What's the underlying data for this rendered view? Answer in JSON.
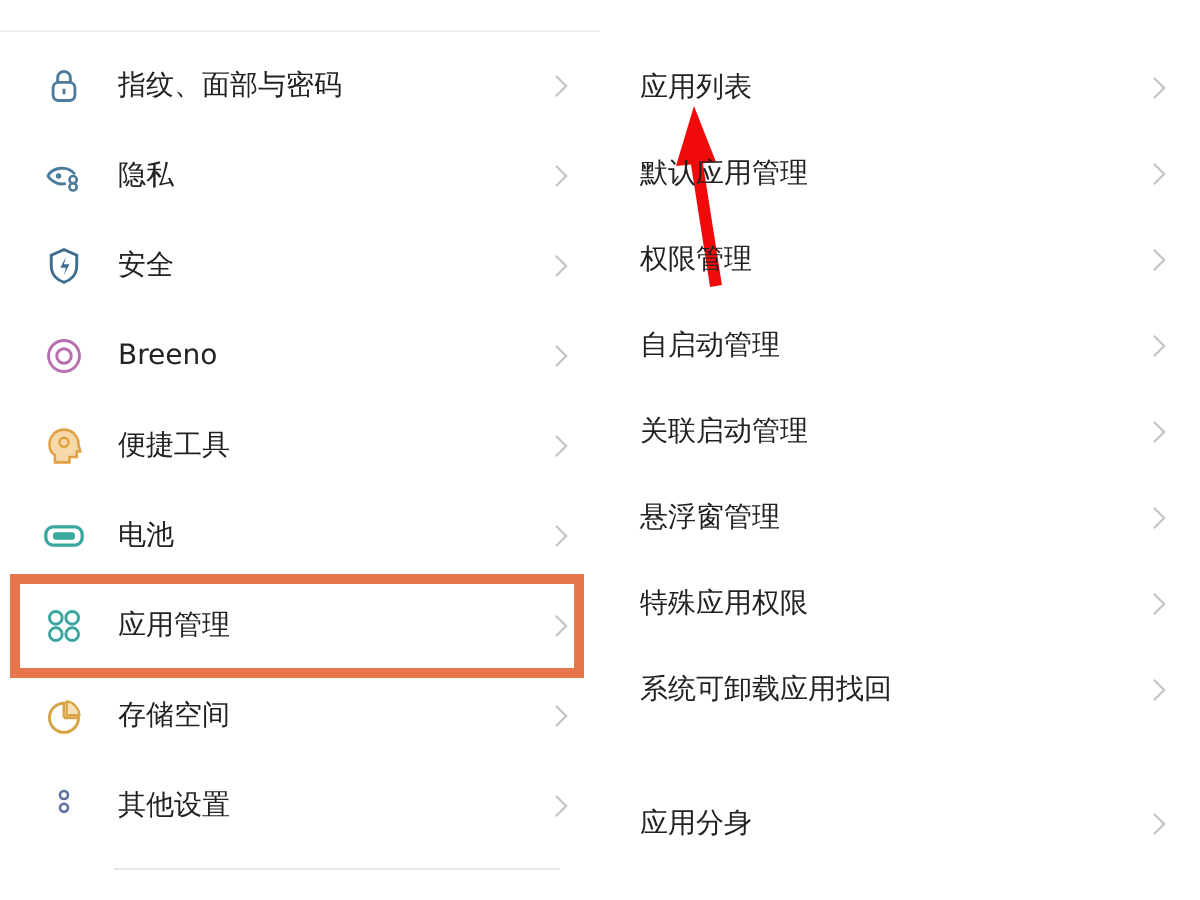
{
  "settings_list": [
    {
      "label": "指纹、面部与密码",
      "highlighted": false
    },
    {
      "label": "隐私",
      "highlighted": false
    },
    {
      "label": "安全",
      "highlighted": false
    },
    {
      "label": "Breeno",
      "highlighted": false
    },
    {
      "label": "便捷工具",
      "highlighted": false
    },
    {
      "label": "电池",
      "highlighted": false
    },
    {
      "label": "应用管理",
      "highlighted": true
    },
    {
      "label": "存储空间",
      "highlighted": false
    },
    {
      "label": "其他设置",
      "highlighted": false
    }
  ],
  "app_management_groups": [
    {
      "items": [
        {
          "label": "应用列表"
        },
        {
          "label": "默认应用管理"
        },
        {
          "label": "权限管理"
        },
        {
          "label": "自启动管理"
        },
        {
          "label": "关联启动管理"
        },
        {
          "label": "悬浮窗管理"
        },
        {
          "label": "特殊应用权限"
        },
        {
          "label": "系统可卸载应用找回"
        }
      ]
    },
    {
      "items": [
        {
          "label": "应用分身"
        }
      ]
    }
  ],
  "annotations": [
    {
      "kind": "arrow"
    }
  ]
}
